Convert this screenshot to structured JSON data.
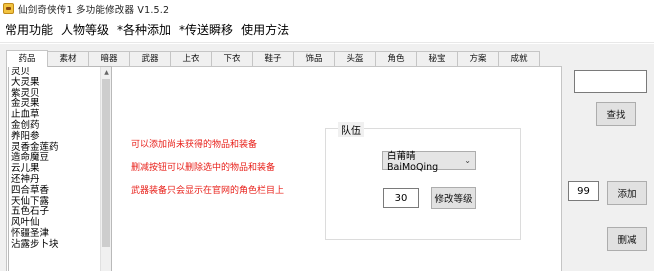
{
  "window": {
    "title": "仙剑奇侠传1 多功能修改器 V1.5.2"
  },
  "menubar": {
    "items": [
      "常用功能",
      "人物等级",
      "*各种添加",
      "*传送瞬移",
      "使用方法"
    ]
  },
  "tabs": [
    "药品",
    "素材",
    "暗器",
    "武器",
    "上衣",
    "下衣",
    "鞋子",
    "饰品",
    "头盔",
    "角色",
    "秘宝",
    "方案",
    "成就"
  ],
  "items_list": [
    "灵贝",
    "大灵果",
    "紫灵贝",
    "金灵果",
    "止血草",
    "金创药",
    "养阳参",
    "灵香金莲药",
    "造命魔豆",
    "云儿果",
    "还神丹",
    "四合草香",
    "天仙下露",
    "五色石子",
    "风叶仙",
    "怀疆圣津",
    "沾露步卜块"
  ],
  "hints": [
    "可以添加尚未获得的物品和装备",
    "删减按钮可以删除选中的物品和装备",
    "武器装备只会显示在官网的角色栏目上"
  ],
  "team": {
    "label": "队伍",
    "selected_member": "白莆晴BaiMoQing",
    "level_value": "30",
    "modify_level_label": "修改等级"
  },
  "side": {
    "search_value": "",
    "search_label": "查找",
    "quantity_value": "99",
    "add_label": "添加",
    "delete_label": "删减"
  }
}
